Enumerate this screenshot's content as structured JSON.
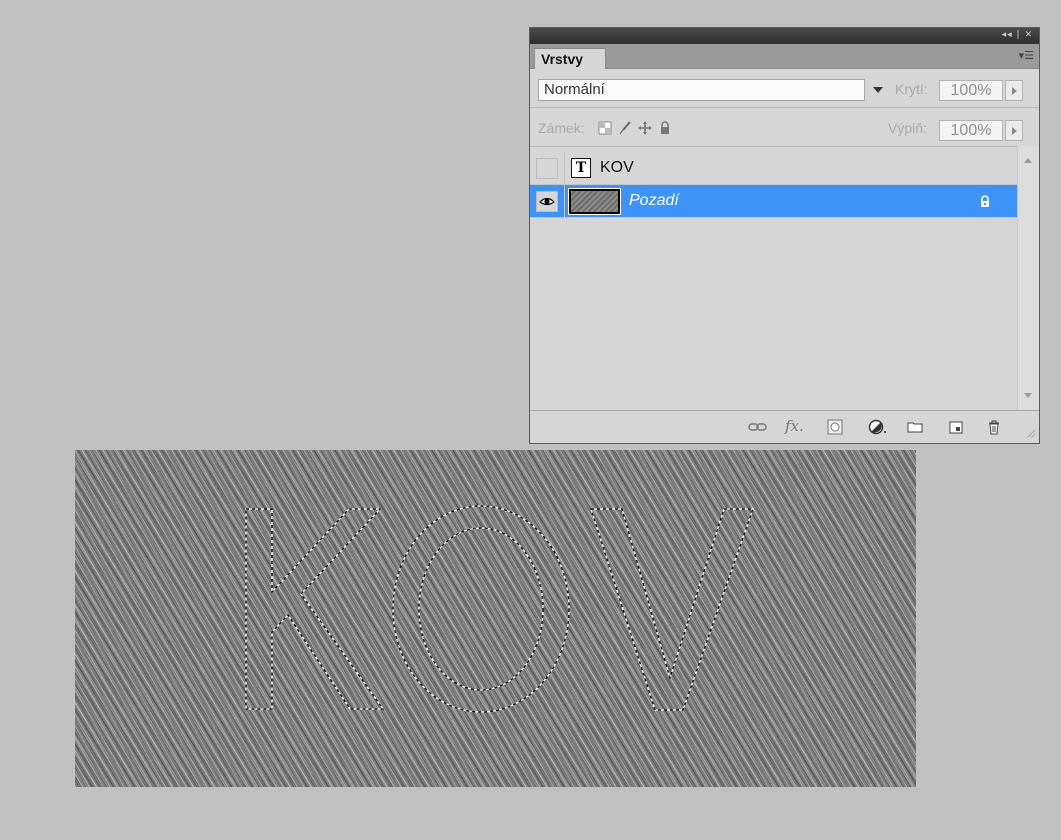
{
  "panel": {
    "tab_label": "Vrstvy",
    "title_controls": "◂◂ | ✕",
    "blend_mode": "Normální",
    "opacity_label": "Krytí:",
    "opacity_value": "100%",
    "lock_label": "Zámek:",
    "fill_label": "Výplň:",
    "fill_value": "100%",
    "layers": [
      {
        "name": "KOV",
        "type": "text",
        "visible": false,
        "selected": false
      },
      {
        "name": "Pozadí",
        "type": "image",
        "visible": true,
        "selected": true,
        "locked": true
      }
    ],
    "footer_icons": [
      "link-layers-icon",
      "fx-icon",
      "layer-mask-icon",
      "adjustment-layer-icon",
      "new-group-icon",
      "new-layer-icon",
      "trash-icon"
    ]
  },
  "canvas": {
    "selection_text": "KOV",
    "texture": "brushed-metal"
  },
  "colors": {
    "workspace": "#c0c0c0",
    "panel": "#d6d6d6",
    "selected_row": "#3d94f6"
  }
}
